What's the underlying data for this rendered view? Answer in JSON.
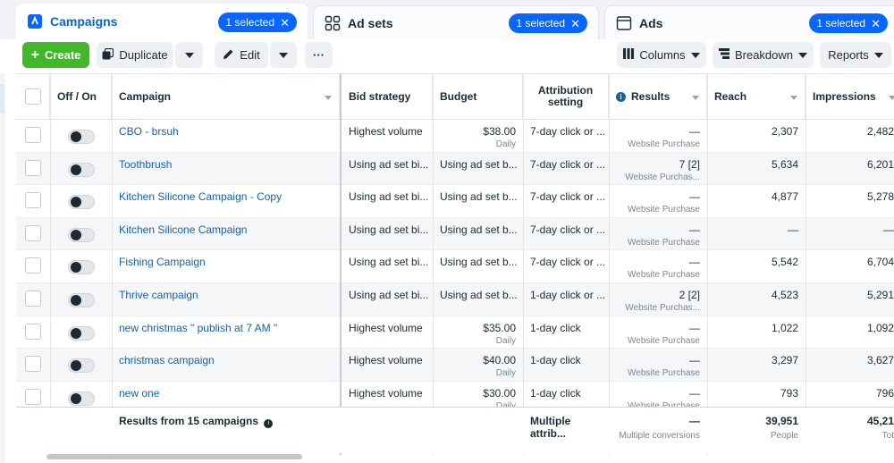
{
  "tabs": [
    {
      "label": "Campaigns",
      "selected": "1 selected"
    },
    {
      "label": "Ad sets",
      "selected": "1 selected"
    },
    {
      "label": "Ads",
      "selected": "1 selected"
    }
  ],
  "toolbar": {
    "create": "Create",
    "duplicate": "Duplicate",
    "edit": "Edit",
    "more": "···",
    "columns": "Columns",
    "breakdown": "Breakdown",
    "reports": "Reports"
  },
  "headers": {
    "offon": "Off / On",
    "campaign": "Campaign",
    "bid": "Bid strategy",
    "budget": "Budget",
    "attribution": "Attribution setting",
    "results": "Results",
    "reach": "Reach",
    "impressions": "Impressions"
  },
  "rows": [
    {
      "name": "CBO - brsuh",
      "bid": "Highest volume",
      "budget": "$38.00",
      "budget_sub": "Daily",
      "attr": "7-day click or ...",
      "result": "—",
      "result_sub": "Website Purchase",
      "reach": "2,307",
      "impr": "2,482"
    },
    {
      "name": "Toothbrush",
      "bid": "Using ad set bi...",
      "budget": "Using ad set b...",
      "budget_sub": "",
      "attr": "7-day click or ...",
      "result": "7 [2]",
      "result_sub": "Website Purchas...",
      "reach": "5,634",
      "impr": "6,201"
    },
    {
      "name": "Kitchen Silicone Campaign - Copy",
      "bid": "Using ad set bi...",
      "budget": "Using ad set b...",
      "budget_sub": "",
      "attr": "7-day click or ...",
      "result": "—",
      "result_sub": "Website Purchase",
      "reach": "4,877",
      "impr": "5,278"
    },
    {
      "name": "Kitchen Silicone Campaign",
      "bid": "Using ad set bi...",
      "budget": "Using ad set b...",
      "budget_sub": "",
      "attr": "7-day click or ...",
      "result": "—",
      "result_sub": "Website Purchase",
      "reach": "—",
      "impr": "—"
    },
    {
      "name": "Fishing Campaign",
      "bid": "Using ad set bi...",
      "budget": "Using ad set b...",
      "budget_sub": "",
      "attr": "7-day click or ...",
      "result": "—",
      "result_sub": "Website Purchase",
      "reach": "5,542",
      "impr": "6,704"
    },
    {
      "name": "Thrive campaign",
      "bid": "Using ad set bi...",
      "budget": "Using ad set b...",
      "budget_sub": "",
      "attr": "1-day click or ...",
      "result": "2 [2]",
      "result_sub": "Website Purchas...",
      "reach": "4,523",
      "impr": "5,291"
    },
    {
      "name": "new christmas \" publish at 7 AM \"",
      "bid": "Highest volume",
      "budget": "$35.00",
      "budget_sub": "Daily",
      "attr": "1-day click",
      "result": "—",
      "result_sub": "Website Purchase",
      "reach": "1,022",
      "impr": "1,092"
    },
    {
      "name": "christmas campaign",
      "bid": "Highest volume",
      "budget": "$40.00",
      "budget_sub": "Daily",
      "attr": "1-day click",
      "result": "—",
      "result_sub": "Website Purchase",
      "reach": "3,297",
      "impr": "3,627"
    },
    {
      "name": "new one",
      "bid": "Highest volume",
      "budget": "$30.00",
      "budget_sub": "Daily",
      "attr": "1-day click",
      "result": "—",
      "result_sub": "Website Purchase",
      "reach": "793",
      "impr": "796"
    }
  ],
  "footer": {
    "label": "Results from 15 campaigns",
    "attribution": "Multiple attrib...",
    "result": "—",
    "result_sub": "Multiple conversions",
    "reach": "39,951",
    "reach_sub": "People",
    "impr": "45,21",
    "impr_sub": "Tot"
  },
  "colors": {
    "accent": "#0866ff",
    "create": "#42b72a",
    "link": "#1462a8"
  }
}
